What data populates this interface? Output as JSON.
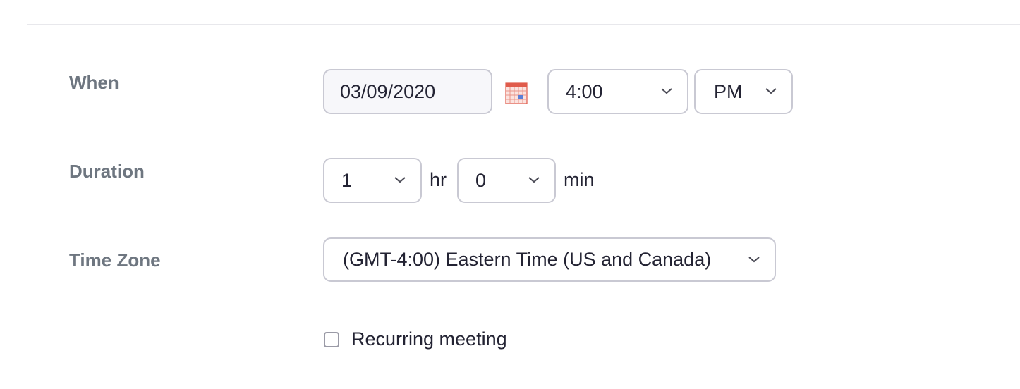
{
  "when": {
    "label": "When",
    "date": "03/09/2020",
    "time": "4:00",
    "ampm": "PM"
  },
  "duration": {
    "label": "Duration",
    "hours": "1",
    "hours_unit": "hr",
    "minutes": "0",
    "minutes_unit": "min"
  },
  "timezone": {
    "label": "Time Zone",
    "value": "(GMT-4:00) Eastern Time (US and Canada)"
  },
  "recurring": {
    "label": "Recurring meeting",
    "checked": false
  },
  "icons": {
    "calendar": "calendar-icon",
    "dropdown": "chevron-down-icon"
  },
  "colors": {
    "label_text": "#6e7680",
    "field_border": "#c9c9d3",
    "value_text": "#232333",
    "calendar_icon": "#e05b4b"
  }
}
